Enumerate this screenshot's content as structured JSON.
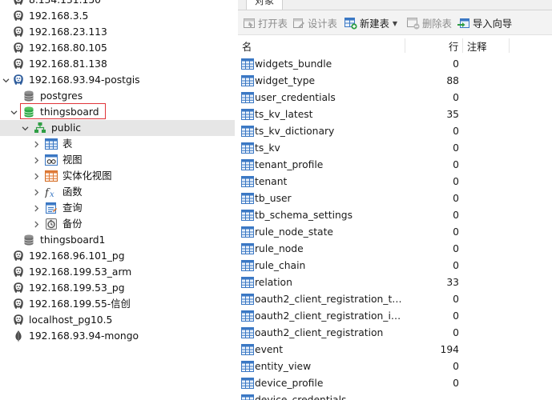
{
  "tree": {
    "items": [
      {
        "label": "8.134.131.150",
        "kind": "pg",
        "expander": "none"
      },
      {
        "label": "192.168.3.5",
        "kind": "pg",
        "expander": "none"
      },
      {
        "label": "192.168.23.113",
        "kind": "pg",
        "expander": "none"
      },
      {
        "label": "192.168.80.105",
        "kind": "pg",
        "expander": "none"
      },
      {
        "label": "192.168.81.138",
        "kind": "pg",
        "expander": "none"
      },
      {
        "label": "192.168.93.94-postgis",
        "kind": "pg-open",
        "expander": "down"
      },
      {
        "label": "postgres",
        "kind": "db-gray",
        "expander": "none"
      },
      {
        "label": "thingsboard",
        "kind": "db-green",
        "expander": "down"
      },
      {
        "label": "public",
        "kind": "schema",
        "expander": "down"
      },
      {
        "label": "表",
        "kind": "table",
        "expander": "right"
      },
      {
        "label": "视图",
        "kind": "view",
        "expander": "right"
      },
      {
        "label": "实体化视图",
        "kind": "matview",
        "expander": "right"
      },
      {
        "label": "函数",
        "kind": "function",
        "expander": "right"
      },
      {
        "label": "查询",
        "kind": "query",
        "expander": "right"
      },
      {
        "label": "备份",
        "kind": "backup",
        "expander": "right"
      },
      {
        "label": "thingsboard1",
        "kind": "db-gray",
        "expander": "none"
      },
      {
        "label": "192.168.96.101_pg",
        "kind": "pg",
        "expander": "none"
      },
      {
        "label": "192.168.199.53_arm",
        "kind": "pg",
        "expander": "none"
      },
      {
        "label": "192.168.199.53_pg",
        "kind": "pg",
        "expander": "none"
      },
      {
        "label": "192.168.199.55-信创",
        "kind": "pg",
        "expander": "none"
      },
      {
        "label": "localhost_pg10.5",
        "kind": "pg",
        "expander": "none"
      },
      {
        "label": "192.168.93.94-mongo",
        "kind": "mongo",
        "expander": "none"
      }
    ],
    "selected_index": 8,
    "highlighted_index": 7
  },
  "tabs": {
    "objects": "对象"
  },
  "toolbar": {
    "open_table": "打开表",
    "design_table": "设计表",
    "new_table": "新建表",
    "delete_table": "删除表",
    "import_wizard": "导入向导"
  },
  "columns": {
    "name": "名",
    "rows": "行",
    "comment": "注释"
  },
  "tables": [
    {
      "name": "widgets_bundle",
      "rows": "0"
    },
    {
      "name": "widget_type",
      "rows": "88"
    },
    {
      "name": "user_credentials",
      "rows": "0"
    },
    {
      "name": "ts_kv_latest",
      "rows": "35"
    },
    {
      "name": "ts_kv_dictionary",
      "rows": "0"
    },
    {
      "name": "ts_kv",
      "rows": "0"
    },
    {
      "name": "tenant_profile",
      "rows": "0"
    },
    {
      "name": "tenant",
      "rows": "0"
    },
    {
      "name": "tb_user",
      "rows": "0"
    },
    {
      "name": "tb_schema_settings",
      "rows": "0"
    },
    {
      "name": "rule_node_state",
      "rows": "0"
    },
    {
      "name": "rule_node",
      "rows": "0"
    },
    {
      "name": "rule_chain",
      "rows": "0"
    },
    {
      "name": "relation",
      "rows": "33"
    },
    {
      "name": "oauth2_client_registration_tem...",
      "rows": "0"
    },
    {
      "name": "oauth2_client_registration_info",
      "rows": "0"
    },
    {
      "name": "oauth2_client_registration",
      "rows": "0"
    },
    {
      "name": "event",
      "rows": "194"
    },
    {
      "name": "entity_view",
      "rows": "0"
    },
    {
      "name": "device_profile",
      "rows": "0"
    },
    {
      "name": "device_credentials",
      "rows": ""
    }
  ],
  "colors": {
    "highlight_border": "#e0353a",
    "selected_row": "#e6e6e6",
    "table_icon_blue": "#3b78c4",
    "database_green": "#29a745"
  }
}
